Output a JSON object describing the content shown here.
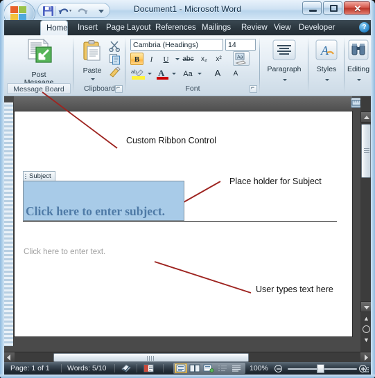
{
  "window": {
    "title": "Document1  -  Microsoft Word",
    "minimize_label": "Minimize",
    "maximize_label": "Maximize",
    "close_label": "✕"
  },
  "quick_access": {
    "save_label": "Save",
    "undo_label": "Undo",
    "redo_label": "Redo",
    "customize_label": "Customize Quick Access Toolbar"
  },
  "office_button": {
    "label": "Office Button"
  },
  "tabs": [
    {
      "label": "Home",
      "active": true
    },
    {
      "label": "Insert",
      "active": false
    },
    {
      "label": "Page Layout",
      "active": false
    },
    {
      "label": "References",
      "active": false
    },
    {
      "label": "Mailings",
      "active": false
    },
    {
      "label": "Review",
      "active": false
    },
    {
      "label": "View",
      "active": false
    },
    {
      "label": "Developer",
      "active": false
    }
  ],
  "help": {
    "label": "?"
  },
  "ribbon": {
    "groups": [
      {
        "name": "message-board",
        "label": "Message Board",
        "highlighted": true,
        "buttons": [
          {
            "label_line1": "Post",
            "label_line2": "Message",
            "icon": "post-message-icon"
          }
        ]
      },
      {
        "name": "clipboard",
        "label": "Clipboard",
        "has_launcher": true,
        "buttons": [
          {
            "label": "Paste",
            "icon": "paste-icon"
          },
          {
            "label": "Cut",
            "icon": "scissors-icon"
          },
          {
            "label": "Copy",
            "icon": "copy-icon"
          },
          {
            "label": "Format Painter",
            "icon": "format-painter-icon"
          }
        ]
      },
      {
        "name": "font",
        "label": "Font",
        "has_launcher": true,
        "font_name": "Cambria (Headings)",
        "font_size": "14",
        "buttons": [
          {
            "label": "B",
            "name": "bold-button",
            "state": "on"
          },
          {
            "label": "I",
            "name": "italic-button"
          },
          {
            "label": "U",
            "name": "underline-button"
          },
          {
            "label": "abc",
            "name": "strikethrough-button"
          },
          {
            "label": "x₂",
            "name": "subscript-button"
          },
          {
            "label": "x²",
            "name": "superscript-button"
          },
          {
            "label": "Aa",
            "name": "clear-formatting-button"
          },
          {
            "label": "ab",
            "name": "text-highlight-button"
          },
          {
            "label": "A",
            "name": "font-color-button"
          },
          {
            "label": "Aa",
            "name": "change-case-button"
          },
          {
            "label": "A",
            "name": "grow-font-button"
          },
          {
            "label": "A",
            "name": "shrink-font-button"
          }
        ]
      },
      {
        "name": "paragraph",
        "label": "Paragraph",
        "icon": "align-lines-icon"
      },
      {
        "name": "styles",
        "label": "Styles",
        "icon": "styles-icon"
      },
      {
        "name": "editing",
        "label": "Editing",
        "icon": "binoculars-icon"
      }
    ]
  },
  "document": {
    "content_control": {
      "tag_label": "Subject",
      "placeholder_text": "Click here to enter subject."
    },
    "body_placeholder": "Click here to enter text."
  },
  "annotations": [
    {
      "name": "annotation-custom-ribbon-control",
      "text": "Custom Ribbon Control"
    },
    {
      "name": "annotation-placeholder-subject",
      "text": "Place holder for Subject"
    },
    {
      "name": "annotation-user-types-text",
      "text": "User types text here"
    }
  ],
  "status_bar": {
    "page_label": "Page: 1 of 1",
    "words_label": "Words: 5/10",
    "proofing_icon": "spell-check-icon",
    "language_icon": "language-icon",
    "views": [
      {
        "name": "print-layout-view",
        "selected": true
      },
      {
        "name": "full-screen-reading-view",
        "selected": false
      },
      {
        "name": "web-layout-view",
        "selected": false
      },
      {
        "name": "outline-view",
        "selected": false
      },
      {
        "name": "draft-view",
        "selected": false
      }
    ],
    "zoom_level": "100%",
    "zoom_out_label": "−",
    "zoom_in_label": "+"
  },
  "colors": {
    "annotation_red": "#9e2420",
    "content_control_fill": "#a8cbe8",
    "content_control_text": "#4e7aa6",
    "accent_blue": "#1f7fc4"
  }
}
